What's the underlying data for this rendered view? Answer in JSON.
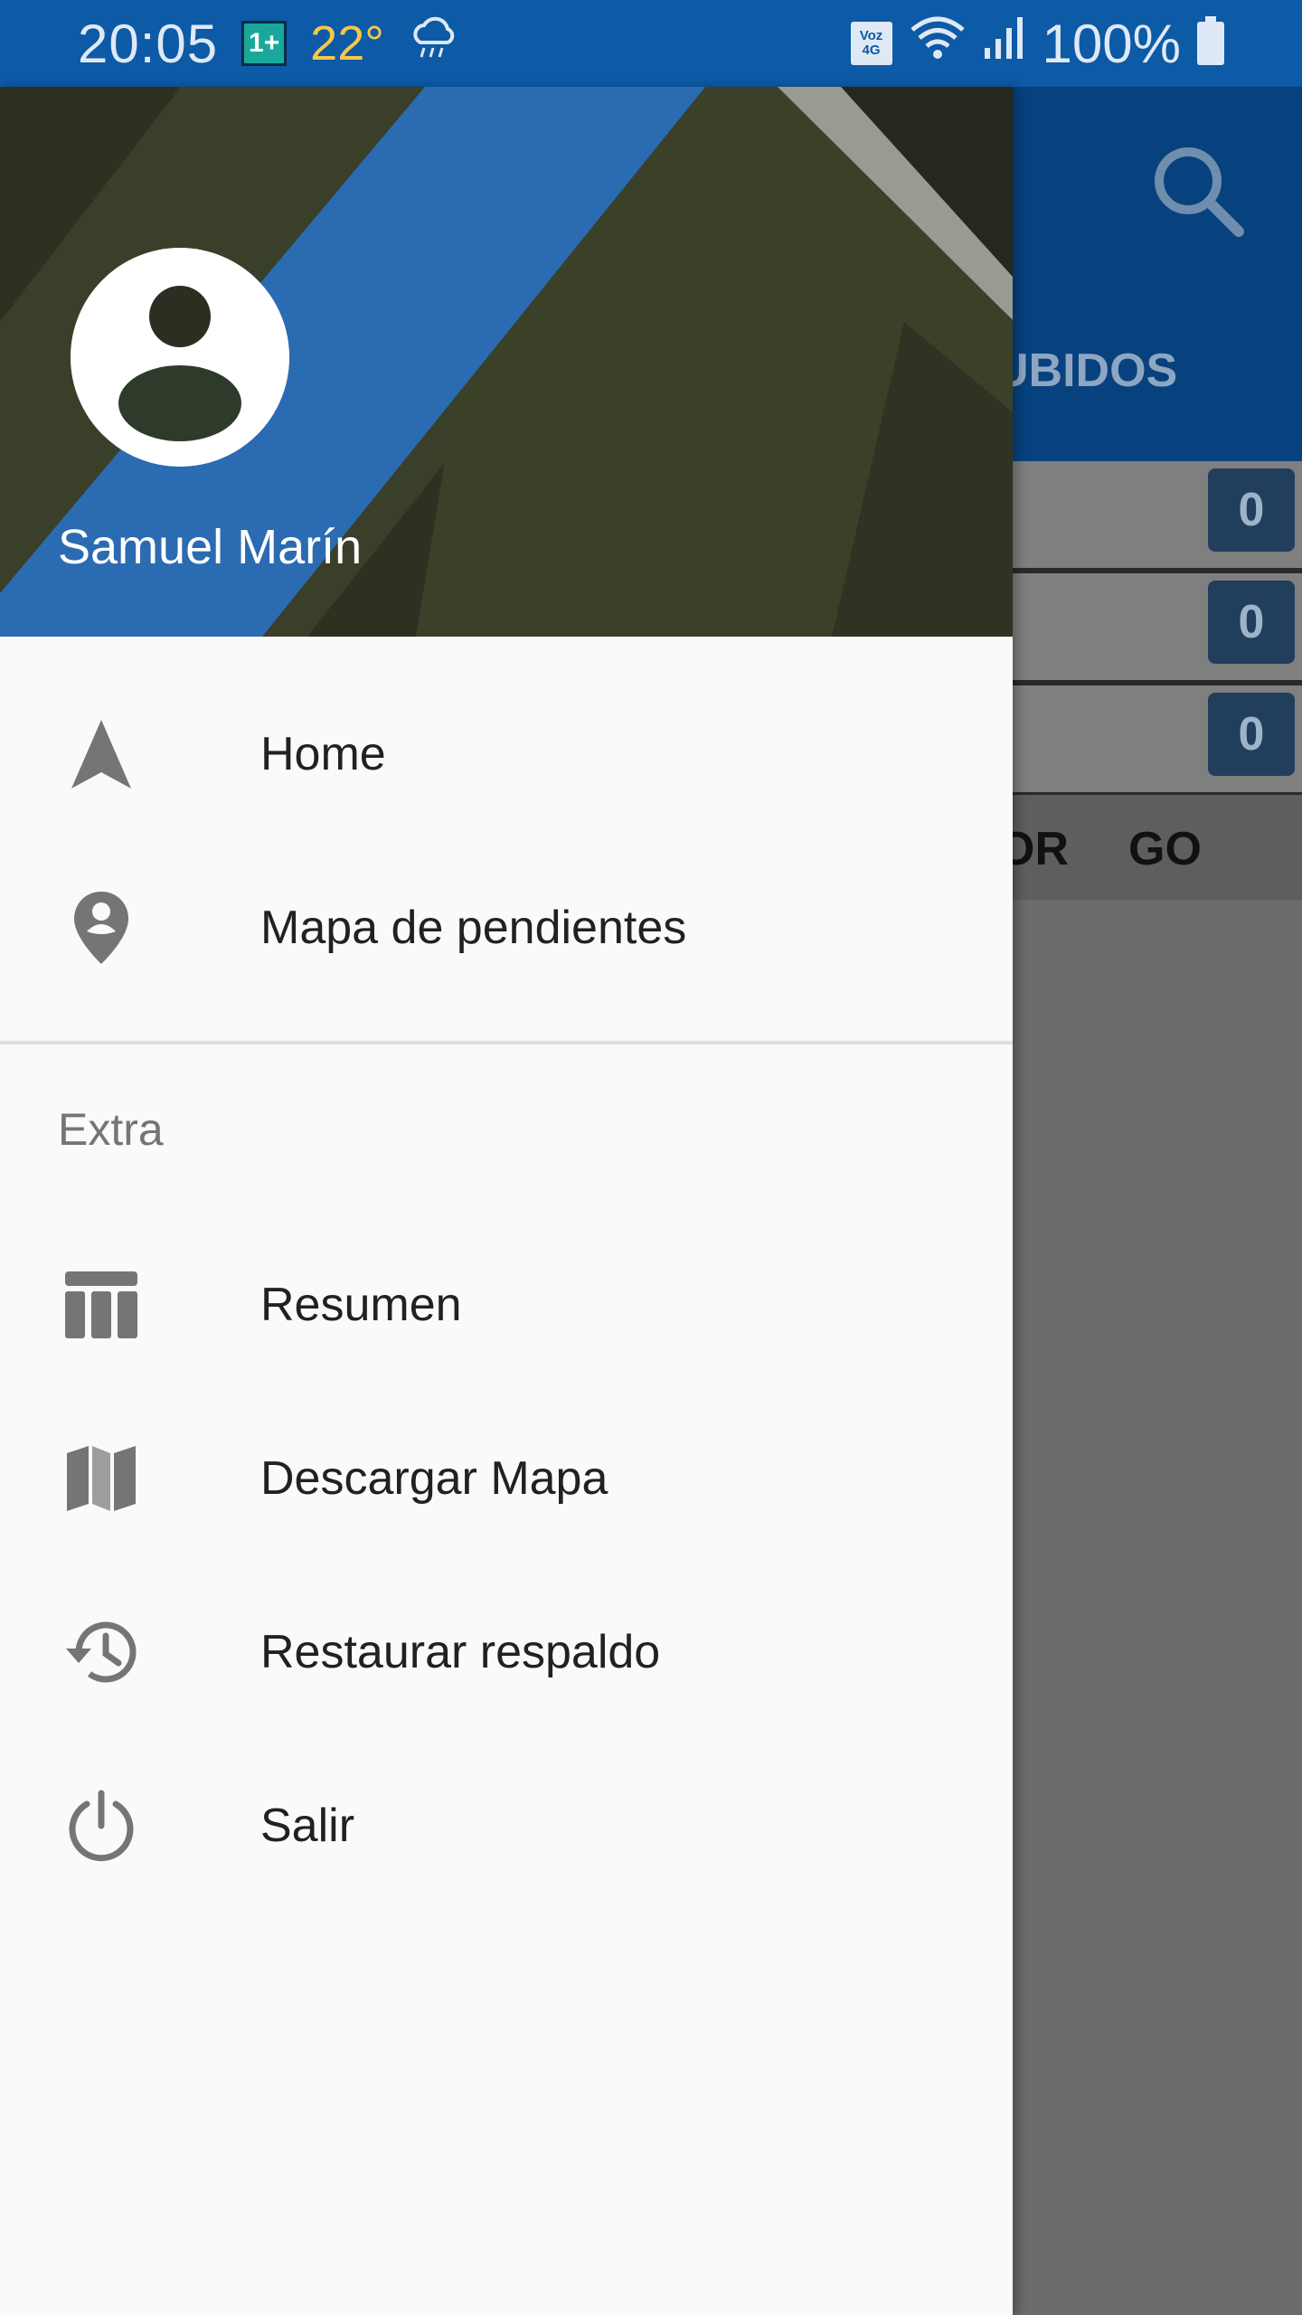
{
  "status_bar": {
    "time": "20:05",
    "carrier_badge": "1+",
    "temperature": "22°",
    "weather_icon": "rain-cloud-icon",
    "volte_top": "Voz",
    "volte_bottom": "4G",
    "battery": "100%"
  },
  "background_app": {
    "tab_partial": "UBIDOS",
    "counts": [
      "0",
      "0",
      "0"
    ],
    "columns": [
      "OR",
      "GO"
    ]
  },
  "drawer": {
    "user_name": "Samuel Marín",
    "items_primary": [
      {
        "label": "Home",
        "icon": "navigation-arrow-icon"
      },
      {
        "label": "Mapa de pendientes",
        "icon": "location-pin-icon"
      }
    ],
    "section_title": "Extra",
    "items_extra": [
      {
        "label": "Resumen",
        "icon": "table-icon"
      },
      {
        "label": "Descargar Mapa",
        "icon": "map-icon"
      },
      {
        "label": "Restaurar respaldo",
        "icon": "history-icon"
      },
      {
        "label": "Salir",
        "icon": "power-icon"
      }
    ]
  },
  "colors": {
    "status_bar": "#0d5aa6",
    "toolbar": "#07427f",
    "drawer_bg": "#fafafa",
    "icon_gray": "#757575",
    "header_blue_stripe": "#2b6bb2"
  }
}
